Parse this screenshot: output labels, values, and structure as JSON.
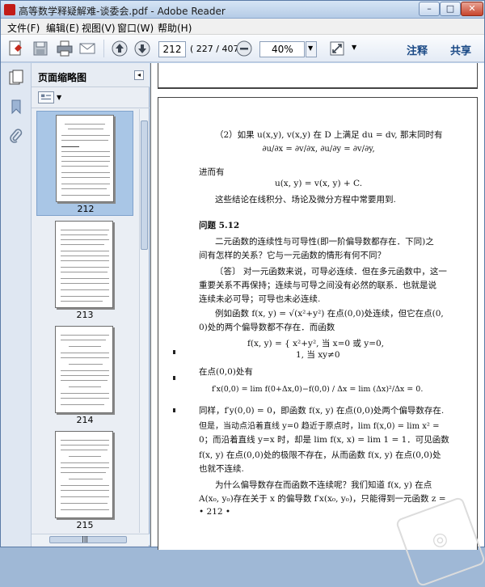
{
  "window": {
    "title": "高等数学释疑解难-谈委会.pdf - Adobe Reader",
    "controls": {
      "minimize": "–",
      "maximize": "□",
      "close": "✕"
    }
  },
  "menu": [
    {
      "label": "文件(F)"
    },
    {
      "label": "编辑(E)"
    },
    {
      "label": "视图(V)"
    },
    {
      "label": "窗口(W)"
    },
    {
      "label": "帮助(H)"
    }
  ],
  "toolbar": {
    "page_current": "212",
    "page_count": "( 227 / 407 )",
    "zoom": "40%",
    "comment": "注释",
    "share": "共享"
  },
  "panel": {
    "title": "页面缩略图",
    "thumbnails": [
      {
        "label": "212",
        "selected": true
      },
      {
        "label": "213",
        "selected": false
      },
      {
        "label": "214",
        "selected": false
      },
      {
        "label": "215",
        "selected": false
      }
    ]
  },
  "page": {
    "lines": [
      "（2）如果 u(x,y), v(x,y) 在 D 上满足 du = dv, 那末同时有",
      "∂u/∂x = ∂v/∂x,  ∂u/∂y = ∂v/∂y,",
      "进而有",
      "u(x, y) = v(x, y) + C.",
      "这些结论在线积分、场论及微分方程中常要用到.",
      "问题 5.12",
      "二元函数的连续性与可导性(即一阶偏导数都存在．下同)之",
      "间有怎样的关系？它与一元函数的情形有何不同？",
      "〔答〕 对一元函数来说，可导必连续．但在多元函数中，这一",
      "重要关系不再保持；连续与可导之间没有必然的联系．也就是说",
      "连续未必可导；可导也未必连续.",
      "例如函数 f(x, y) = √(x²+y²) 在点(0,0)处连续，但它在点(0,",
      "0)处的两个偏导数都不存在．而函数",
      "f(x, y) = { x²+y², 当 x=0 或 y=0,",
      "1,  当 xy≠0",
      "在点(0,0)处有",
      "f′x(0,0) = lim f(0+Δx,0)−f(0,0) / Δx = lim (Δx)²/Δx = 0.",
      "同样，f′y(0,0) = 0，即函数 f(x, y) 在点(0,0)处两个偏导数存在.",
      "但是，当动点沿着直线 y=0 趋近于原点时，lim f(x,0) = lim x² =",
      "0；而沿着直线 y=x 时，却是 lim f(x, x) = lim 1 = 1．可见函数",
      "f(x, y) 在点(0,0)处的极限不存在，从而函数 f(x, y) 在点(0,0)处",
      "也就不连续.",
      "为什么偏导数存在而函数不连续呢？我们知道 f(x, y) 在点",
      "A(x₀, y₀)存在关于 x 的偏导数 f′x(x₀, y₀)，只能得到一元函数 z =",
      "• 212 •"
    ]
  }
}
